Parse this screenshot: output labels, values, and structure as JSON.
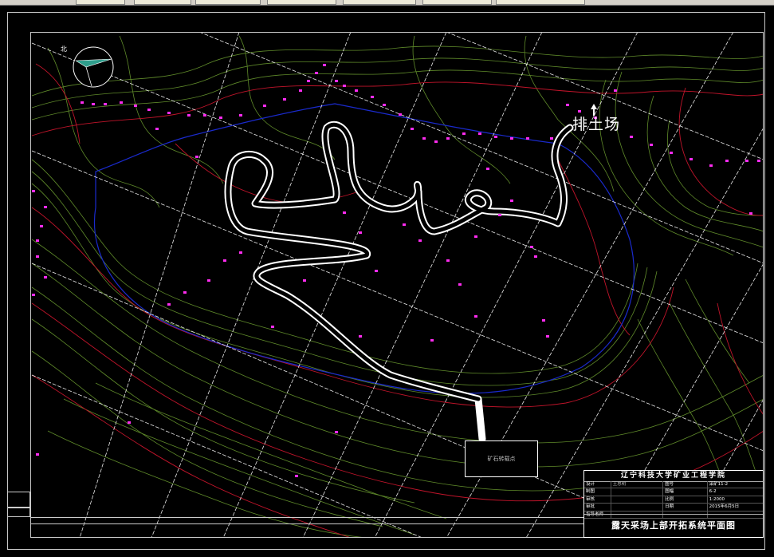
{
  "drawing": {
    "dump_label": "排土场",
    "ore_box_label": "矿石转载点",
    "north_label": "北"
  },
  "title_block": {
    "school": "辽宁科技大学矿业工程学院",
    "rows": [
      [
        "设计",
        "王思明",
        "图号",
        "采矿11-2"
      ],
      [
        "制图",
        "",
        "图幅",
        "6-2"
      ],
      [
        "审核",
        "",
        "比例",
        "1:2000"
      ],
      [
        "审批",
        "",
        "日期",
        "2015年6月5日"
      ],
      [
        "指导老师",
        "",
        "",
        ""
      ]
    ],
    "drawing_title": "露天采场上部开拓系统平面图"
  },
  "colors": {
    "background": "#000000",
    "contour_green": "#5f8a2a",
    "contour_red": "#c0142a",
    "boundary_blue": "#1a2acc",
    "marker_magenta": "#ff2cf0",
    "road_white": "#ffffff",
    "grid_white": "#e8e8e8"
  }
}
